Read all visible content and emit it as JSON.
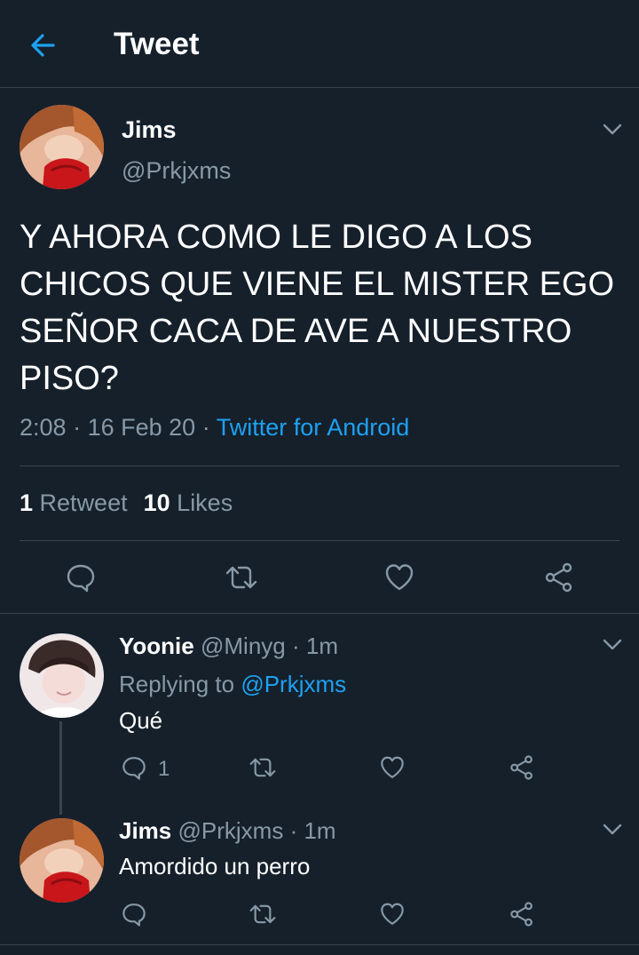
{
  "header": {
    "title": "Tweet"
  },
  "tweet": {
    "name": "Jims",
    "handle": "@Prkjxms",
    "text_lines": [
      "Y AHORA COMO LE DIGO A LOS",
      "CHICOS QUE VIENE EL MISTER EGO",
      "SEÑOR CACA DE AVE A NUESTRO",
      "PISO?"
    ],
    "time": "2:08",
    "date": "16 Feb 20",
    "sep": "·",
    "source": "Twitter for Android",
    "retweets_count": "1",
    "retweets_label": "Retweet",
    "likes_count": "10",
    "likes_label": "Likes"
  },
  "replies": [
    {
      "name": "Yoonie",
      "handle": "@Minyg",
      "sep": "·",
      "time": "1m",
      "replying_prefix": "Replying to",
      "replying_to": "@Prkjxms",
      "text": "Qué",
      "reply_count": "1"
    },
    {
      "name": "Jims",
      "handle": "@Prkjxms",
      "sep": "·",
      "time": "1m",
      "text": "Amordido un perro"
    }
  ],
  "colors": {
    "background": "#15202b",
    "accent": "#1da1f2",
    "muted": "#8899a6",
    "divider": "#38444d"
  },
  "icons": {
    "back": "arrow-left-icon",
    "menu": "chevron-down-icon",
    "reply": "comment-icon",
    "retweet": "retweet-icon",
    "like": "heart-icon",
    "share": "share-icon"
  }
}
